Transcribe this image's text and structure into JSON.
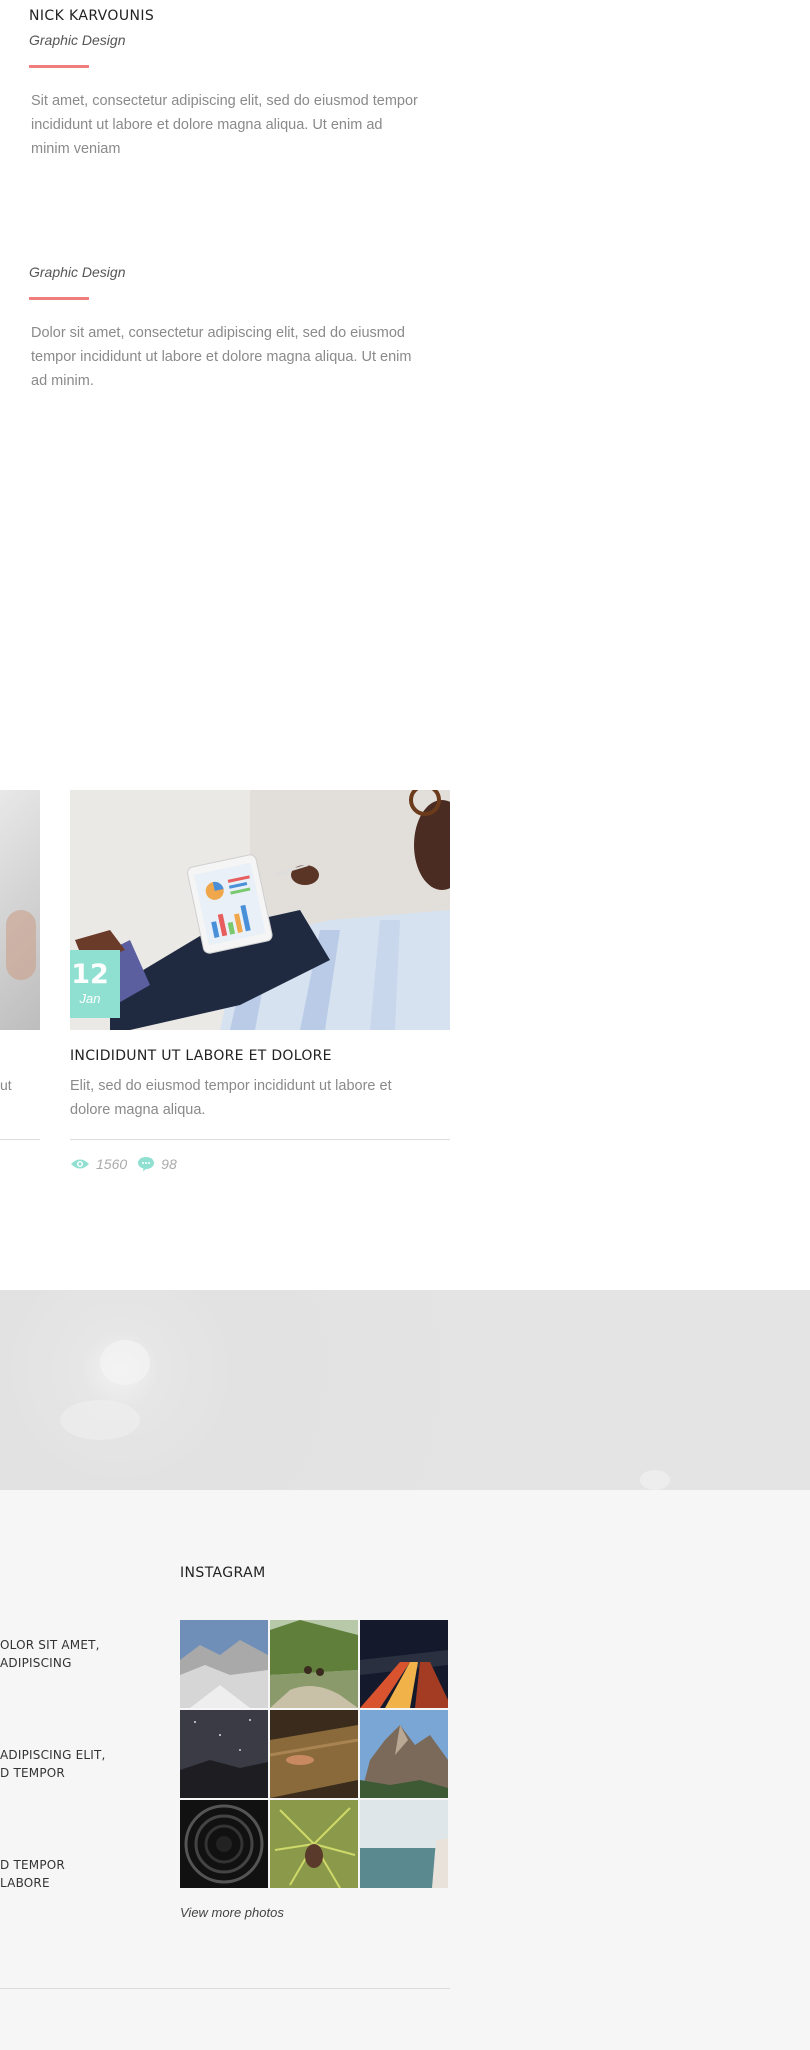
{
  "team": [
    {
      "name": "NICK KARVOUNIS",
      "role": "Graphic Design",
      "bio": "Sit amet, consectetur adipiscing elit, sed do eiusmod tempor incididunt ut labore et dolore magna aliqua. Ut enim ad minim veniam"
    },
    {
      "name": "",
      "role": "Graphic Design",
      "bio": "Dolor sit amet, consectetur adipiscing elit, sed do eiusmod tempor incididunt ut labore et dolore magna aliqua. Ut enim ad minim."
    }
  ],
  "blog": {
    "partial_excerpt": "ut",
    "card": {
      "date_day": "12",
      "date_month": "Jan",
      "title": "INCIDIDUNT UT LABORE ET DOLORE",
      "excerpt": "Elit, sed do eiusmod tempor incididunt ut labore et dolore magna aliqua.",
      "views": "1560",
      "comments": "98"
    }
  },
  "footer": {
    "recent_posts": [
      {
        "line1": "OLOR SIT AMET,",
        "line2": "ADIPISCING"
      },
      {
        "line1": "ADIPISCING ELIT,",
        "line2": "D TEMPOR"
      },
      {
        "line1": "D TEMPOR",
        "line2": "LABORE"
      }
    ],
    "instagram": {
      "title": "INSTAGRAM",
      "photos": [
        {
          "icon": "mountain-snow-photo"
        },
        {
          "icon": "hikers-valley-photo"
        },
        {
          "icon": "night-highway-photo"
        },
        {
          "icon": "starry-sky-photo"
        },
        {
          "icon": "wooden-surface-photo"
        },
        {
          "icon": "rocky-peak-photo"
        },
        {
          "icon": "tunnel-photo"
        },
        {
          "icon": "pine-cone-photo"
        },
        {
          "icon": "sea-horizon-photo"
        }
      ],
      "view_more": "View more photos"
    }
  },
  "colors": {
    "accent_red": "#ef7f7f",
    "accent_teal": "#8fe0d1"
  }
}
